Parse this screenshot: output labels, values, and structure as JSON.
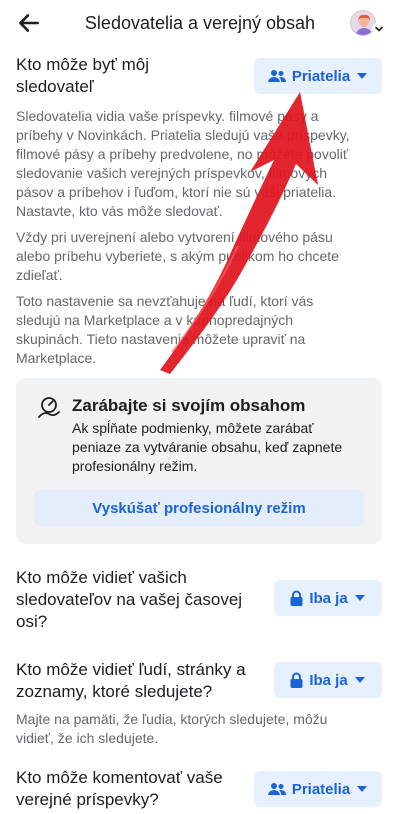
{
  "header": {
    "title": "Sledovatelia a verejný obsah",
    "back_icon": "arrow-left-icon",
    "avatar_icon": "profile-avatar-icon"
  },
  "followers": {
    "question_line1": "Kto môže byť môj",
    "question_line2": "sledovateľ",
    "button_label": "Priatelia",
    "paragraphs": [
      [
        "Sledovatelia vidia vaše príspevky. filmové pásy a",
        "príbehy v Novinkách. Priatelia sledujú vaše príspevky,",
        "filmové pásy a príbehy predvolene, no môžete povoliť",
        "sledovanie vašich verejných príspevkov, filmových",
        "pásov a príbehov i ľuďom, ktorí nie sú vaši priatelia.",
        "Nastavte, kto vás môže sledovať."
      ],
      [
        "Vždy pri uverejnení alebo vytvorení filmového pásu",
        "alebo príbehu vyberiete, s akým publikom ho chcete",
        "zdieľať."
      ],
      [
        "Toto nastavenie sa nevzťahuje na ľudí, ktorí vás",
        "sledujú na Marketplace a v kúpnopredajných",
        "skupinách. Tieto nastavenia môžete upraviť na",
        "Marketplace."
      ]
    ]
  },
  "professional_card": {
    "icon": "professional-dashboard-icon",
    "title": "Zarábajte si svojím obsahom",
    "text_lines": [
      "Ak spĺňate podmienky, môžete zarábať",
      "peniaze za vytváranie obsahu, keď zapnete",
      "profesionálny režim."
    ],
    "button_label": "Vyskúšať profesionálny režim"
  },
  "followers_list": {
    "question_lines": [
      "Kto môže vidieť vašich",
      "sledovateľov na vašej časovej",
      "osi?"
    ],
    "button_label": "Iba ja"
  },
  "following_list": {
    "question_lines": [
      "Kto môže vidieť ľudí, stránky a",
      "zoznamy, ktoré sledujete?"
    ],
    "button_label": "Iba ja",
    "note_lines": [
      "Majte na pamäti, že ľudia, ktorých sledujete, môžu",
      "vidieť, že ich sledujete."
    ]
  },
  "comments": {
    "question_lines": [
      "Kto môže komentovať vaše",
      "verejné príspevky?"
    ],
    "button_label": "Priatelia"
  },
  "colors": {
    "accent": "#1b64d8",
    "pill_bg": "#e7f0fd",
    "card_bg": "#f0f2f5",
    "annotation_arrow": "#e0141e"
  },
  "annotation": {
    "icon": "red-arrow-annotation"
  }
}
